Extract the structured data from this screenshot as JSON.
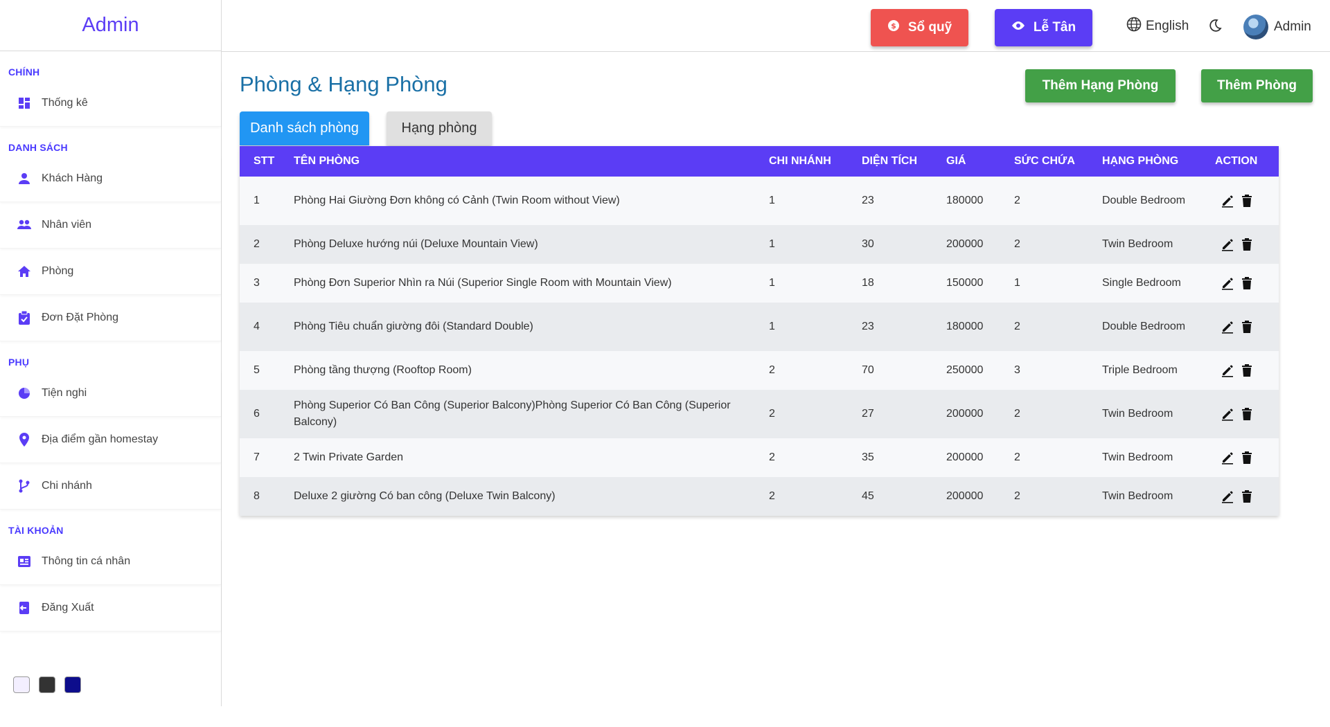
{
  "sidebar": {
    "brand": "Admin",
    "sections": [
      {
        "heading": "CHÍNH",
        "items": [
          {
            "label": "Thống kê",
            "icon": "dashboard-icon"
          }
        ]
      },
      {
        "heading": "DANH SÁCH",
        "items": [
          {
            "label": "Khách Hàng",
            "icon": "person-icon"
          },
          {
            "label": "Nhân viên",
            "icon": "people-icon"
          },
          {
            "label": "Phòng",
            "icon": "home-icon"
          },
          {
            "label": "Đơn Đặt Phòng",
            "icon": "clipboard-icon"
          }
        ]
      },
      {
        "heading": "PHỤ",
        "items": [
          {
            "label": "Tiện nghi",
            "icon": "pie-icon"
          },
          {
            "label": "Địa điểm gần homestay",
            "icon": "location-pin-icon"
          },
          {
            "label": "Chi nhánh",
            "icon": "branch-icon"
          }
        ]
      },
      {
        "heading": "TÀI KHOẢN",
        "items": [
          {
            "label": "Thông tin cá nhân",
            "icon": "id-card-icon"
          },
          {
            "label": "Đăng Xuất",
            "icon": "logout-icon"
          }
        ]
      }
    ],
    "theme_swatches": [
      "#f3efff",
      "#333333",
      "#0d0d8c"
    ]
  },
  "topbar": {
    "so_quy": "Sổ quỹ",
    "le_tan": "Lễ Tân",
    "language": "English",
    "user": "Admin"
  },
  "page": {
    "title": "Phòng & Hạng Phòng",
    "add_room_type": "Thêm Hạng Phòng",
    "add_room": "Thêm Phòng",
    "tabs": [
      "Danh sách phòng",
      "Hạng phòng"
    ]
  },
  "table": {
    "headers": [
      "STT",
      "TÊN PHÒNG",
      "CHI NHÁNH",
      "DIỆN TÍCH",
      "GIÁ",
      "SỨC CHỨA",
      "HẠNG PHÒNG",
      "ACTION"
    ],
    "rows": [
      {
        "stt": "1",
        "name": "Phòng Hai Giường Đơn không có Cảnh (Twin Room without View)",
        "branch": "1",
        "area": "23",
        "price": "180000",
        "capacity": "2",
        "type": "Double Bedroom"
      },
      {
        "stt": "2",
        "name": "Phòng Deluxe hướng núi (Deluxe Mountain View)",
        "branch": "1",
        "area": "30",
        "price": "200000",
        "capacity": "2",
        "type": "Twin Bedroom"
      },
      {
        "stt": "3",
        "name": "Phòng Đơn Superior Nhìn ra Núi (Superior Single Room with Mountain View)",
        "branch": "1",
        "area": "18",
        "price": "150000",
        "capacity": "1",
        "type": "Single Bedroom"
      },
      {
        "stt": "4",
        "name": "Phòng Tiêu chuẩn giường đôi (Standard Double)",
        "branch": "1",
        "area": "23",
        "price": "180000",
        "capacity": "2",
        "type": "Double Bedroom"
      },
      {
        "stt": "5",
        "name": "Phòng tầng thượng (Rooftop Room)",
        "branch": "2",
        "area": "70",
        "price": "250000",
        "capacity": "3",
        "type": "Triple Bedroom"
      },
      {
        "stt": "6",
        "name": "Phòng Superior Có Ban Công (Superior Balcony)Phòng Superior Có Ban Công (Superior Balcony)",
        "branch": "2",
        "area": "27",
        "price": "200000",
        "capacity": "2",
        "type": "Twin Bedroom"
      },
      {
        "stt": "7",
        "name": "2 Twin Private Garden",
        "branch": "2",
        "area": "35",
        "price": "200000",
        "capacity": "2",
        "type": "Twin Bedroom"
      },
      {
        "stt": "8",
        "name": "Deluxe 2 giường Có ban công (Deluxe Twin Balcony)",
        "branch": "2",
        "area": "45",
        "price": "200000",
        "capacity": "2",
        "type": "Twin Bedroom"
      }
    ]
  },
  "colors": {
    "primary": "#5b3df5",
    "title": "#1a70a6",
    "tab_active": "#2196f3",
    "success": "#43a047",
    "danger": "#ef5350"
  }
}
